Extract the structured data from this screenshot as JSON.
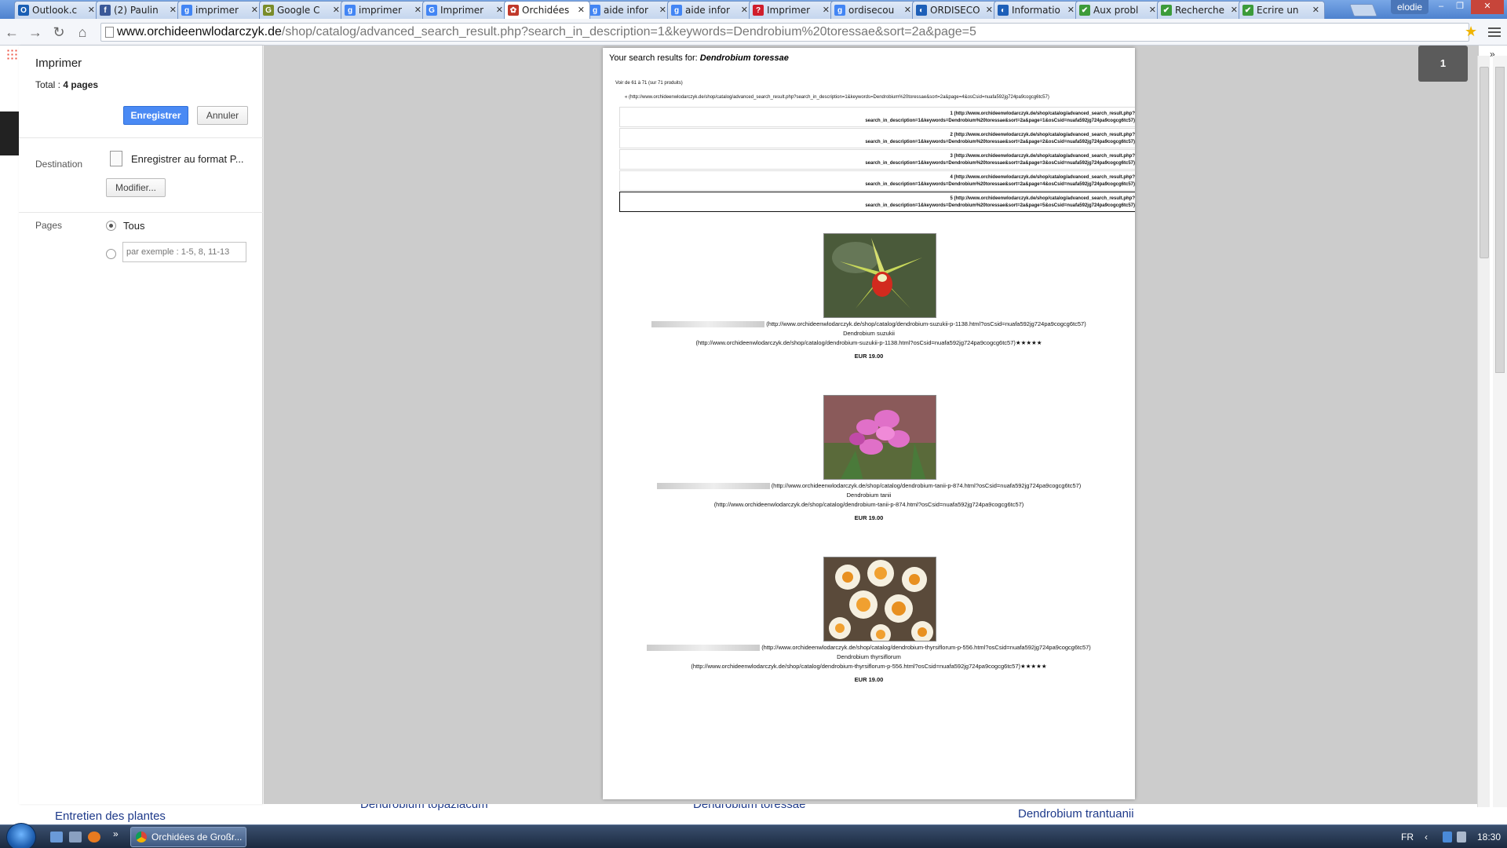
{
  "tabs": [
    {
      "label": "Outlook.c",
      "icon": "O",
      "color": "#1a5fb4"
    },
    {
      "label": "(2) Paulin",
      "icon": "f",
      "color": "#3b5998"
    },
    {
      "label": "imprimer",
      "icon": "g",
      "color": "#4285f4"
    },
    {
      "label": "Google C",
      "icon": "G",
      "color": "#7a8c2a"
    },
    {
      "label": "imprimer",
      "icon": "g",
      "color": "#4285f4"
    },
    {
      "label": "Imprimer",
      "icon": "G",
      "color": "#4285f4"
    },
    {
      "label": "Orchidées",
      "icon": "✿",
      "color": "#c0392b"
    },
    {
      "label": "aide infor",
      "icon": "g",
      "color": "#4285f4"
    },
    {
      "label": "aide infor",
      "icon": "g",
      "color": "#4285f4"
    },
    {
      "label": "Imprimer",
      "icon": "?",
      "color": "#d01d2a"
    },
    {
      "label": "ordisecou",
      "icon": "g",
      "color": "#4285f4"
    },
    {
      "label": "ORDISECO",
      "icon": "◐",
      "color": "#1d5fb8"
    },
    {
      "label": "Informatio",
      "icon": "◐",
      "color": "#1d5fb8"
    },
    {
      "label": "Aux probl",
      "icon": "✔",
      "color": "#3c9b3a"
    },
    {
      "label": "Recherche",
      "icon": "✔",
      "color": "#3c9b3a"
    },
    {
      "label": "Ecrire un",
      "icon": "✔",
      "color": "#3c9b3a"
    }
  ],
  "window": {
    "user": "elodie",
    "minimize": "–",
    "maximize": "❐",
    "close": "✕"
  },
  "address": {
    "host": "www.orchideenwlodarczyk.de",
    "path": "/shop/catalog/advanced_search_result.php?search_in_description=1&keywords=Dendrobium%20toressae&sort=2a&page=5"
  },
  "nav": {
    "back": "←",
    "forward": "→",
    "reload": "↻",
    "home": "⌂",
    "star": "★"
  },
  "print_panel": {
    "title": "Imprimer",
    "total_label": "Total : ",
    "total_value": "4 pages",
    "save_button": "Enregistrer",
    "cancel_button": "Annuler",
    "destination_label": "Destination",
    "destination_value": "Enregistrer au format P...",
    "modify_button": "Modifier...",
    "pages_label": "Pages",
    "pages_all": "Tous",
    "pages_placeholder": "par exemple : 1-5, 8, 11-13"
  },
  "preview": {
    "page_badge": "1",
    "collapse": "»",
    "search_prefix": "Your search results for: ",
    "search_term": "Dendrobium toressae",
    "result_count": "Voir de 61 à 71 (sur 71 produits)",
    "prev_link": "« (http://www.orchideenwlodarczyk.de/shop/catalog/advanced_search_result.php?search_in_description=1&keywords=Dendrobium%20toressae&sort=2a&page=4&osCsid=nuafa592jg724pa9cogcg6tc57)",
    "pages": [
      {
        "l1": "1 (http://www.orchideenwlodarczyk.de/shop/catalog/advanced_search_result.php?",
        "l2": "search_in_description=1&keywords=Dendrobium%20toressae&sort=2a&page=1&osCsid=nuafa592jg724pa9cogcg6tc57)"
      },
      {
        "l1": "2 (http://www.orchideenwlodarczyk.de/shop/catalog/advanced_search_result.php?",
        "l2": "search_in_description=1&keywords=Dendrobium%20toressae&sort=2a&page=2&osCsid=nuafa592jg724pa9cogcg6tc57)"
      },
      {
        "l1": "3 (http://www.orchideenwlodarczyk.de/shop/catalog/advanced_search_result.php?",
        "l2": "search_in_description=1&keywords=Dendrobium%20toressae&sort=2a&page=3&osCsid=nuafa592jg724pa9cogcg6tc57)"
      },
      {
        "l1": "4 (http://www.orchideenwlodarczyk.de/shop/catalog/advanced_search_result.php?",
        "l2": "search_in_description=1&keywords=Dendrobium%20toressae&sort=2a&page=4&osCsid=nuafa592jg724pa9cogcg6tc57)"
      },
      {
        "l1": "5 (http://www.orchideenwlodarczyk.de/shop/catalog/advanced_search_result.php?",
        "l2": "search_in_description=1&keywords=Dendrobium%20toressae&sort=2a&page=5&osCsid=nuafa592jg724pa9cogcg6tc57)"
      }
    ],
    "products": [
      {
        "img_link": "(http://www.orchideenwlodarczyk.de/shop/catalog/dendrobium-suzukii-p-1138.html?osCsid=nuafa592jg724pa9cogcg6tc57)",
        "name": "Dendrobium suzukii",
        "name_link": "(http://www.orchideenwlodarczyk.de/shop/catalog/dendrobium-suzukii-p-1138.html?osCsid=nuafa592jg724pa9cogcg6tc57)★★★★★",
        "price": "EUR 19.00",
        "colors": [
          "#6a8a3a",
          "#c8d85a",
          "#d22a1e"
        ]
      },
      {
        "img_link": "(http://www.orchideenwlodarczyk.de/shop/catalog/dendrobium-tanii-p-874.html?osCsid=nuafa592jg724pa9cogcg6tc57)",
        "name": "Dendrobium tanii",
        "name_link": "(http://www.orchideenwlodarczyk.de/shop/catalog/dendrobium-tanii-p-874.html?osCsid=nuafa592jg724pa9cogcg6tc57)",
        "price": "EUR 19.00",
        "colors": [
          "#7a4a5a",
          "#e070c8",
          "#c04aa8"
        ]
      },
      {
        "img_link": "(http://www.orchideenwlodarczyk.de/shop/catalog/dendrobium-thyrsiflorum-p-556.html?osCsid=nuafa592jg724pa9cogcg6tc57)",
        "name": "Dendrobium thyrsiflorum",
        "name_link": "(http://www.orchideenwlodarczyk.de/shop/catalog/dendrobium-thyrsiflorum-p-556.html?osCsid=nuafa592jg724pa9cogcg6tc57)★★★★★",
        "price": "EUR 19.00",
        "colors": [
          "#e89020",
          "#f6f0e0",
          "#f0a030"
        ]
      }
    ]
  },
  "underlying_page": {
    "link1": "Entretien des plantes",
    "link2": "Dendrobium topaziacum",
    "link3": "Dendrobium toressae",
    "link4": "Dendrobium trantuanii"
  },
  "taskbar": {
    "app_label": "Orchidées de Großr...",
    "lang": "FR",
    "time": "18:30"
  },
  "colors": {
    "accent": "#4a8af4",
    "tabbar": "#5a8ed8",
    "taskbar": "#1b2a40"
  }
}
